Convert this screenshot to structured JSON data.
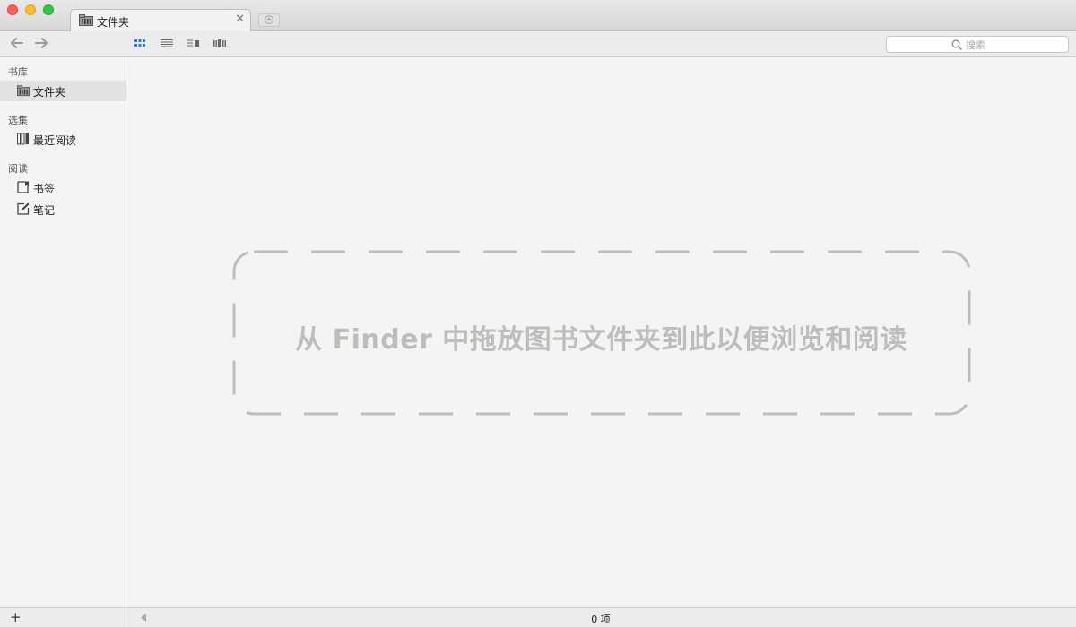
{
  "window": {
    "tab_title": "文件夹",
    "tab_close": "✕",
    "new_tab": "+"
  },
  "toolbar": {
    "back_icon": "arrow-left-icon",
    "forward_icon": "arrow-right-icon",
    "views": [
      "grid-view",
      "list-view",
      "detail-view",
      "cover-flow-view"
    ],
    "active_view": "grid-view",
    "search_placeholder": "搜索"
  },
  "sidebar": {
    "sections": [
      {
        "label": "书库",
        "items": [
          {
            "label": "文件夹",
            "icon": "folder-icon",
            "selected": true
          }
        ]
      },
      {
        "label": "选集",
        "items": [
          {
            "label": "最近阅读",
            "icon": "books-icon",
            "selected": false
          }
        ]
      },
      {
        "label": "阅读",
        "items": [
          {
            "label": "书签",
            "icon": "bookmark-icon",
            "selected": false
          },
          {
            "label": "笔记",
            "icon": "note-icon",
            "selected": false
          }
        ]
      }
    ]
  },
  "main": {
    "drop_hint": "从 Finder 中拖放图书文件夹到此以便浏览和阅读"
  },
  "statusbar": {
    "add_label": "+",
    "item_count": "0 项"
  },
  "colors": {
    "accent": "#2a7ae2",
    "dashed_border": "#bdbdbb",
    "background": "#f4f4f2"
  }
}
